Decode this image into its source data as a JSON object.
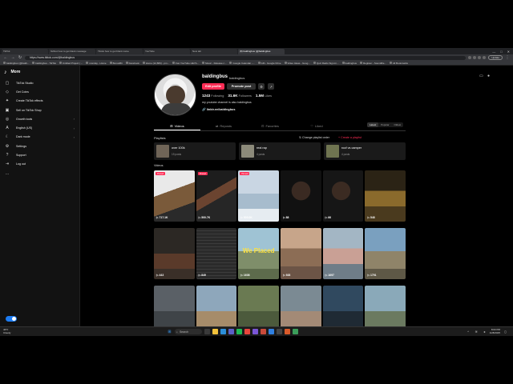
{
  "browser": {
    "tabs": [
      "TikTok",
      "fishbot how to get blank message",
      "Tiktok how to get blank name",
      "YouTube",
      "New tab",
      "(8) baldingbus (@baldingbus"
    ],
    "active_tab_index": 5,
    "url": "https://www.tiktok.com/@baldingbus",
    "update_label": "Update",
    "bookmarks": [
      "baldingbus (@baldi...",
      "baldingbus - TikTok",
      "Untitled Project | ...",
      "monday - Home",
      "BonusBit",
      "Facebook",
      "Home (12,883) - pm...",
      "Fan YouTube HEYA...",
      "Music - Release c...",
      "Google Calendar -...",
      "GM - Google Drive",
      "Video Ideas - Goog...",
      "Quiz Radio Sign-In...",
      "baldingbus",
      "Register - SoundRe...",
      "All Bookmarks"
    ],
    "window_controls": [
      "—",
      "□",
      "✕"
    ]
  },
  "sidebar": {
    "title": "More",
    "logo": "♪",
    "items": [
      {
        "icon": "▢",
        "label": "TikTok Studio"
      },
      {
        "icon": "◇",
        "label": "Get Coins"
      },
      {
        "icon": "✦",
        "label": "Create TikTok effects"
      },
      {
        "icon": "▣",
        "label": "Sell on TikTok Shop"
      },
      {
        "icon": "◎",
        "label": "Growth tools"
      },
      {
        "icon": "A",
        "label": "English (US)"
      },
      {
        "icon": "☾",
        "label": "Dark mode"
      },
      {
        "icon": "⚙",
        "label": "Settings"
      },
      {
        "icon": "?",
        "label": "Support"
      },
      {
        "icon": "⇥",
        "label": "Log out"
      },
      {
        "icon": "…",
        "label": ""
      }
    ]
  },
  "profile": {
    "username": "baldingbus",
    "nickname": "baldingbus",
    "edit_label": "Edit profile",
    "promote_label": "Promote post",
    "following_count": "1243",
    "following_label": "Following",
    "followers_count": "31.6K",
    "followers_label": "Followers",
    "likes_count": "1.5M",
    "likes_label": "Likes",
    "bio": "my youtube channel is also baldingbus",
    "link": "linktr.ee/baldingbus"
  },
  "tabs": [
    {
      "icon": "⊞",
      "label": "Videos"
    },
    {
      "icon": "⇄",
      "label": "Reposts"
    },
    {
      "icon": "⊡",
      "label": "Favorites"
    },
    {
      "icon": "♡",
      "label": "Liked"
    }
  ],
  "sort": [
    "Latest",
    "Popular",
    "Oldest"
  ],
  "playlists": {
    "title": "Playlists",
    "change_label": "⇅ Change playlist order",
    "create_label": "+ Create a playlist",
    "items": [
      {
        "name": "over 100k",
        "count": "19 posts",
        "color": "#6f6457"
      },
      {
        "name": "real rap",
        "count": "4 posts",
        "color": "#8c8a7a"
      },
      {
        "name": "roof vs camper",
        "count": "4 posts",
        "color": "#6f7450"
      }
    ]
  },
  "videos": {
    "title": "Videos",
    "items": [
      {
        "views": "▷ 717.1K",
        "pinned": "Pinned",
        "overlay": "",
        "bg": "linear-gradient(160deg,#e9e9e9 0 40%,#7a5a3a 40% 70%,#2a2a2a 70%)"
      },
      {
        "views": "▷ 500.7K",
        "pinned": "Pinned",
        "overlay": "",
        "bg": "linear-gradient(150deg,#1d1d1d 0 40%,#6b4430 40% 55%,#262626 55%)"
      },
      {
        "views": "▷ 500.0K",
        "pinned": "Pinned",
        "overlay": "",
        "bg": "linear-gradient(180deg,#c9d6e3 0 45%,#a7bccd 45% 75%,#e6ecf1 75%)"
      },
      {
        "views": "▷ 88",
        "pinned": "",
        "overlay": "",
        "bg": "radial-gradient(circle at 50% 40%,#3a2a22 0 25%,#111 26%)"
      },
      {
        "views": "▷ 66",
        "pinned": "",
        "overlay": "",
        "bg": "radial-gradient(circle at 45% 40%,#3b2b22 0 24%,#161616 25%)"
      },
      {
        "views": "▷ 548",
        "pinned": "",
        "overlay": "",
        "bg": "linear-gradient(180deg,#2b2315 0 40%,#8a6a2c 40% 70%,#4a3a1e 70%)"
      },
      {
        "views": "▷ 443",
        "pinned": "",
        "overlay": "",
        "bg": "linear-gradient(180deg,#2c2824 0 50%,#5a3a2a 50% 80%,#3a2f28 80%)"
      },
      {
        "views": "▷ 849",
        "pinned": "",
        "overlay": "",
        "bg": "repeating-linear-gradient(180deg,#2a2a2a 0 3px,#3c3c3c 3px 4px)"
      },
      {
        "views": "▷ 1608",
        "pinned": "",
        "overlay": "We Placed",
        "bg": "linear-gradient(180deg,#9fc3d4 0 45%,#7f8e6a 45% 80%,#5d6b4c 80%)"
      },
      {
        "views": "▷ 928",
        "pinned": "",
        "overlay": "",
        "bg": "linear-gradient(180deg,#c7a58a 0 40%,#8c6d55 40% 75%,#6c5446 75%)"
      },
      {
        "views": "▷ 1697",
        "pinned": "",
        "overlay": "",
        "bg": "linear-gradient(180deg,#a3b6c4 0 40%,#c9a095 40% 70%,#6f7d88 70%)"
      },
      {
        "views": "▷ 1791",
        "pinned": "",
        "overlay": "",
        "bg": "linear-gradient(180deg,#7aa0bf 0 45%,#8f8469 45% 80%,#5e5846 80%)"
      },
      {
        "views": "",
        "pinned": "",
        "overlay": "",
        "bg": "linear-gradient(180deg,#5a6066 0 50%,#3f4448 50%)"
      },
      {
        "views": "",
        "pinned": "",
        "overlay": "",
        "bg": "linear-gradient(180deg,#8ea7bb 0 50%,#a68c6a 50%)"
      },
      {
        "views": "",
        "pinned": "",
        "overlay": "",
        "bg": "linear-gradient(180deg,#6a7a52 0 50%,#4c5a3c 50%)"
      },
      {
        "views": "",
        "pinned": "",
        "overlay": "",
        "bg": "linear-gradient(180deg,#7b8a93 0 50%,#a38a76 50%)"
      },
      {
        "views": "",
        "pinned": "",
        "overlay": "",
        "bg": "linear-gradient(180deg,#30495f 0 50%,#1f2a34 50%)"
      },
      {
        "views": "",
        "pinned": "",
        "overlay": "",
        "bg": "linear-gradient(180deg,#8aa9b9 0 50%,#6b7a60 50%)"
      }
    ]
  },
  "taskbar": {
    "weather_temp": "46°F",
    "weather_desc": "Cloudy",
    "search_label": "Search",
    "time": "8:03 PM",
    "date": "1/28/2025"
  },
  "colors": {
    "accent": "#fe2c55",
    "toggle": "#1d7cf2"
  }
}
